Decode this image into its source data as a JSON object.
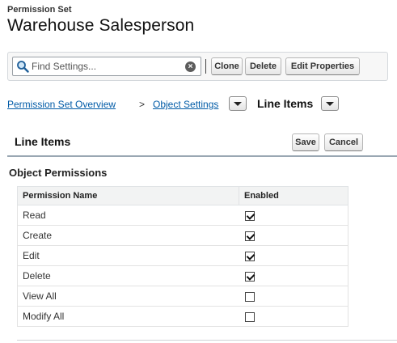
{
  "header": {
    "eyebrow": "Permission Set",
    "title": "Warehouse Salesperson"
  },
  "toolbar": {
    "search_placeholder": "Find Settings...",
    "clone_label": "Clone",
    "delete_label": "Delete",
    "edit_properties_label": "Edit Properties"
  },
  "breadcrumb": {
    "overview_label": "Permission Set Overview",
    "separator": ">",
    "object_settings_label": "Object Settings",
    "current_label": "Line Items"
  },
  "section": {
    "title": "Line Items",
    "save_label": "Save",
    "cancel_label": "Cancel",
    "subheading": "Object Permissions"
  },
  "table": {
    "columns": [
      "Permission Name",
      "Enabled"
    ],
    "rows": [
      {
        "name": "Read",
        "enabled": true
      },
      {
        "name": "Create",
        "enabled": true
      },
      {
        "name": "Edit",
        "enabled": true
      },
      {
        "name": "Delete",
        "enabled": true
      },
      {
        "name": "View All",
        "enabled": false
      },
      {
        "name": "Modify All",
        "enabled": false
      }
    ]
  },
  "icons": {
    "search": "search-icon",
    "clear": "clear-search-icon",
    "dropdown": "chevron-down-icon"
  },
  "colors": {
    "link": "#015ba7",
    "section_rule": "#9aa7b3",
    "table_header_bg": "#f2f3f3"
  }
}
